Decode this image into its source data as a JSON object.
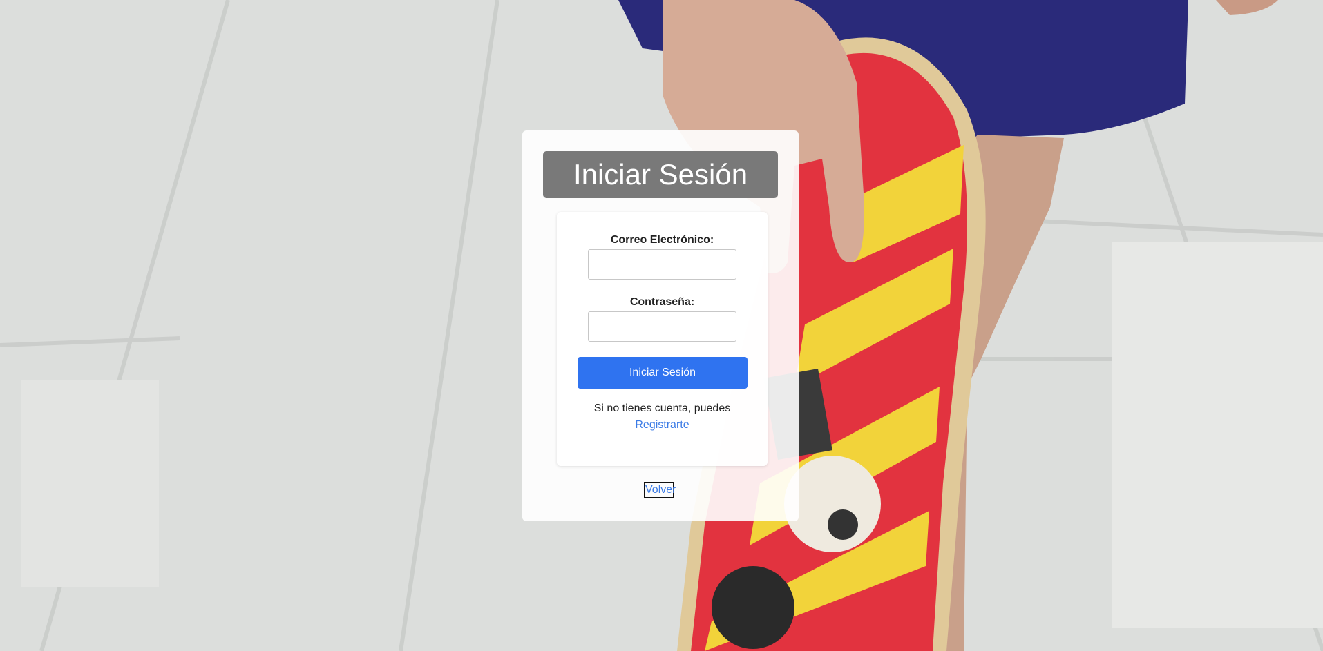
{
  "login": {
    "title": "Iniciar Sesión",
    "email_label": "Correo Electrónico:",
    "email_value": "",
    "password_label": "Contraseña:",
    "password_value": "",
    "submit_label": "Iniciar Sesión",
    "no_account_text": "Si no tienes cuenta, puedes",
    "register_link": "Registrarte",
    "back_link": "Volver"
  },
  "colors": {
    "primary_button": "#2f73f0",
    "link": "#3b7be6",
    "title_background": "#6e6e6e"
  },
  "background_image": "skateboard-photo"
}
